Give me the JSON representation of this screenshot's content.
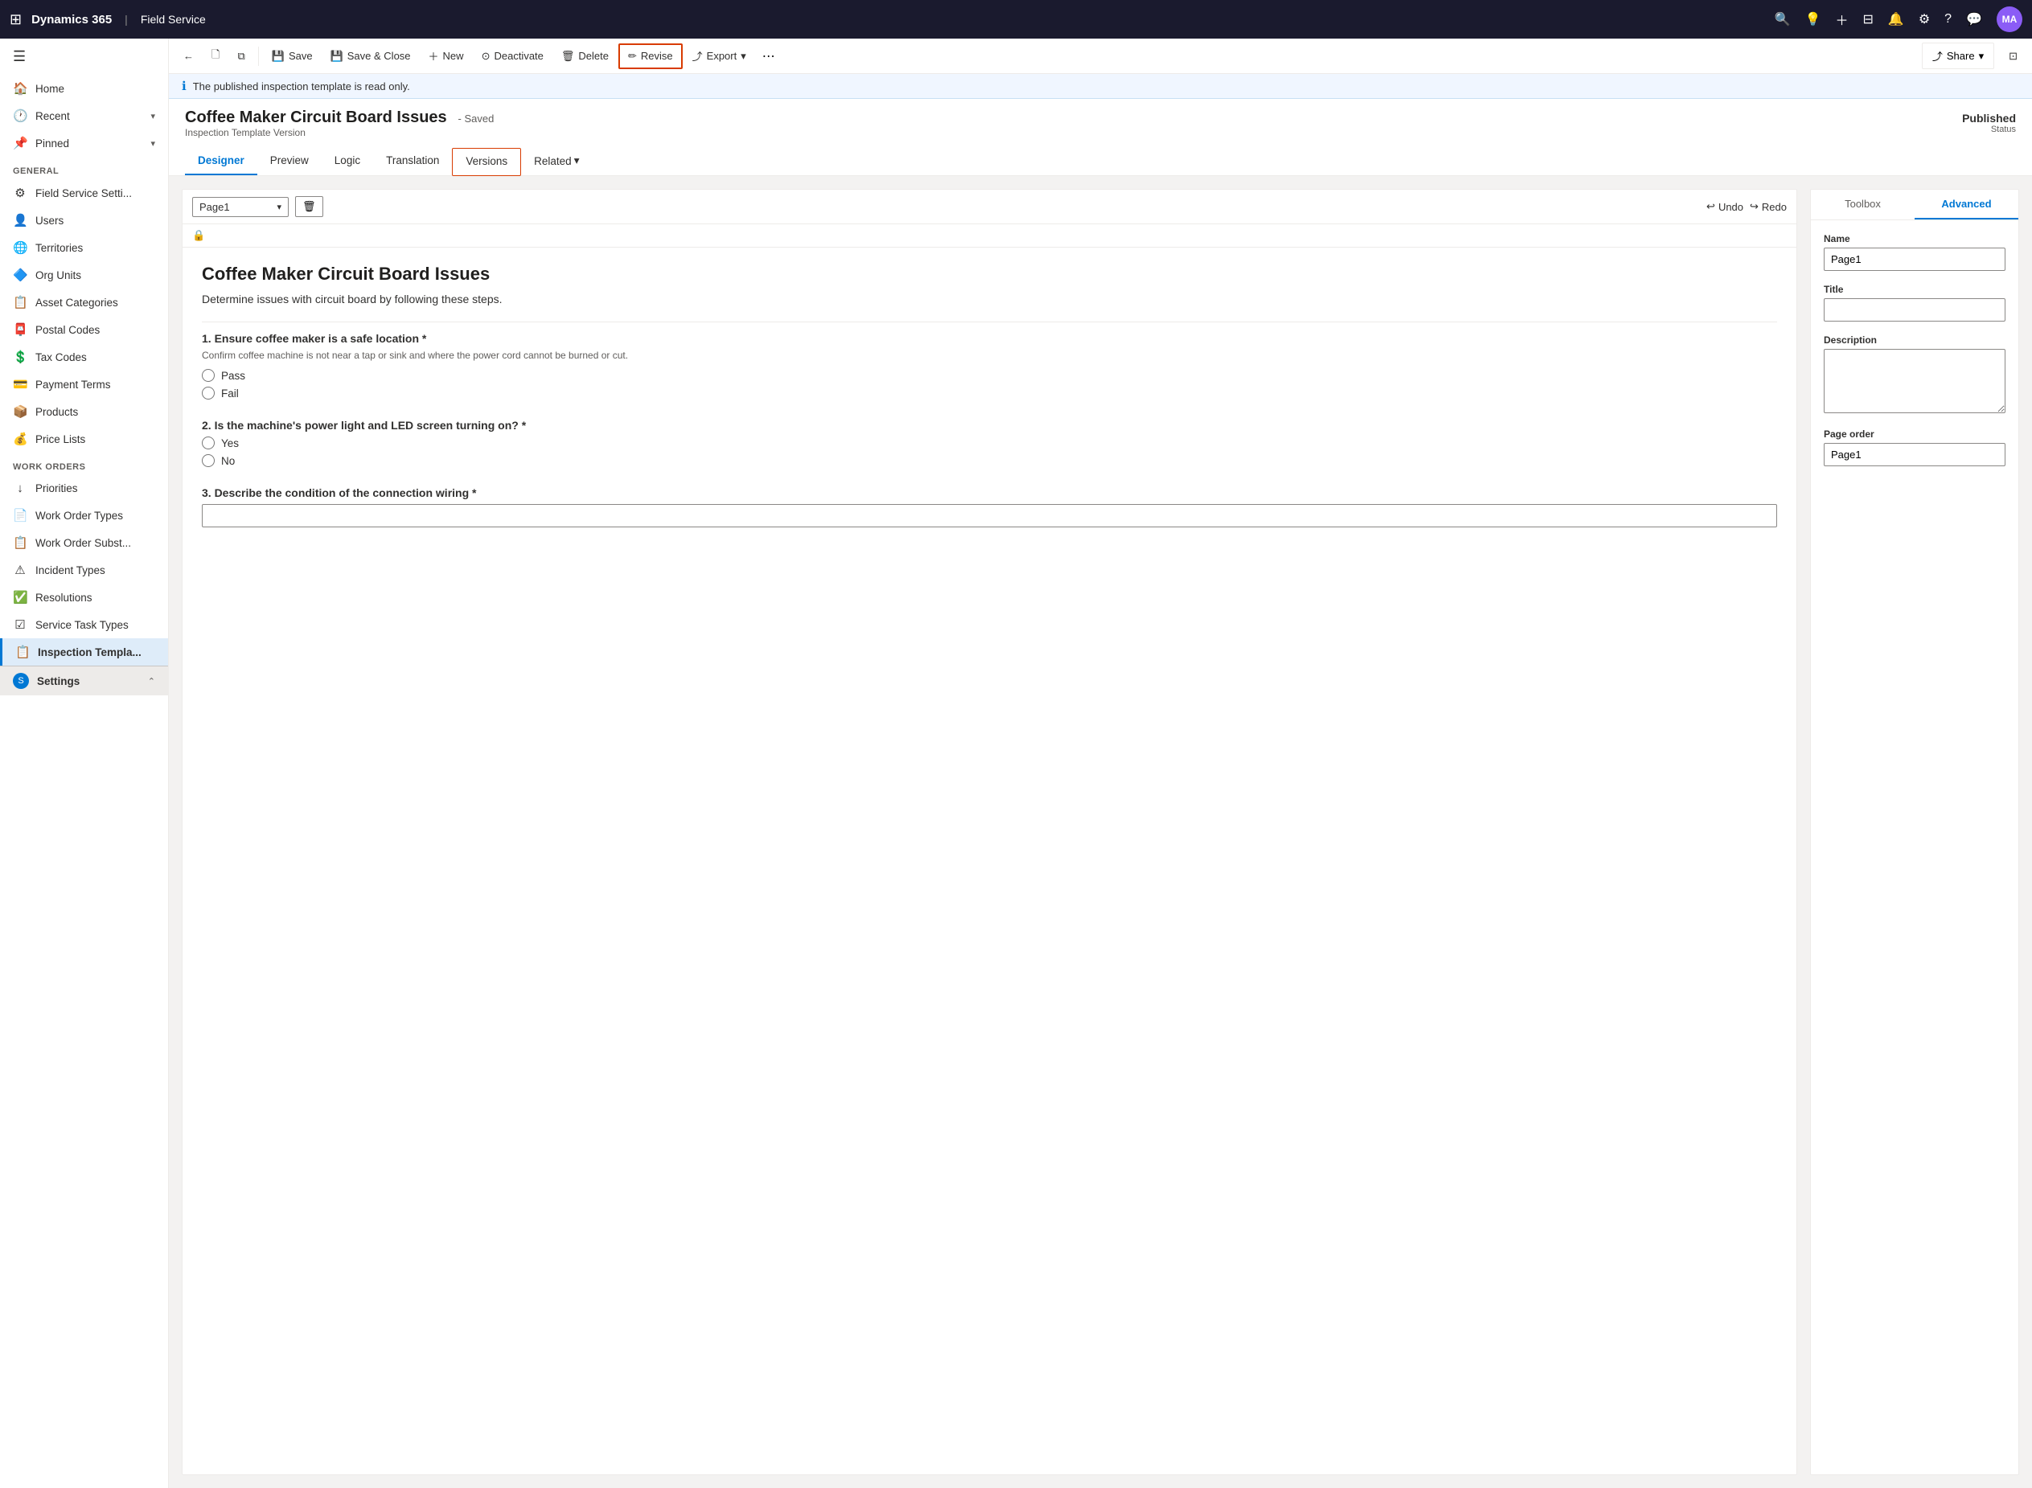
{
  "topnav": {
    "brand": "Dynamics 365",
    "separator": "|",
    "module": "Field Service",
    "avatar_initials": "MA"
  },
  "toolbar": {
    "back_label": "",
    "save_label": "Save",
    "save_close_label": "Save & Close",
    "new_label": "New",
    "deactivate_label": "Deactivate",
    "delete_label": "Delete",
    "revise_label": "Revise",
    "export_label": "Export",
    "share_label": "Share"
  },
  "info_bar": {
    "message": "The published inspection template is read only."
  },
  "page": {
    "title": "Coffee Maker Circuit Board Issues",
    "saved_label": "- Saved",
    "subtitle": "Inspection Template Version",
    "status_value": "Published",
    "status_label": "Status"
  },
  "tabs": [
    {
      "id": "designer",
      "label": "Designer",
      "active": true
    },
    {
      "id": "preview",
      "label": "Preview"
    },
    {
      "id": "logic",
      "label": "Logic"
    },
    {
      "id": "translation",
      "label": "Translation"
    },
    {
      "id": "versions",
      "label": "Versions",
      "highlight": true
    },
    {
      "id": "related",
      "label": "Related",
      "dropdown": true
    }
  ],
  "designer": {
    "page_name": "Page1",
    "undo_label": "Undo",
    "redo_label": "Redo",
    "form_title": "Coffee Maker Circuit Board Issues",
    "form_description": "Determine issues with circuit board by following these steps.",
    "questions": [
      {
        "id": "q1",
        "text": "1. Ensure coffee maker is a safe location *",
        "hint": "Confirm coffee machine is not near a tap or sink and where the power cord cannot be burned or cut.",
        "type": "radio",
        "options": [
          "Pass",
          "Fail"
        ]
      },
      {
        "id": "q2",
        "text": "2. Is the machine's power light and LED screen turning on? *",
        "hint": "",
        "type": "radio",
        "options": [
          "Yes",
          "No"
        ]
      },
      {
        "id": "q3",
        "text": "3. Describe the condition of the connection wiring *",
        "hint": "",
        "type": "text",
        "options": []
      }
    ]
  },
  "advanced_panel": {
    "toolbox_label": "Toolbox",
    "advanced_label": "Advanced",
    "name_label": "Name",
    "name_value": "Page1",
    "title_label": "Title",
    "title_value": "",
    "description_label": "Description",
    "description_value": "",
    "page_order_label": "Page order",
    "page_order_value": "Page1"
  },
  "sidebar": {
    "hamburger": "☰",
    "general_section": "General",
    "work_orders_section": "Work Orders",
    "items": [
      {
        "id": "home",
        "icon": "🏠",
        "label": "Home"
      },
      {
        "id": "recent",
        "icon": "🕐",
        "label": "Recent",
        "expand": true
      },
      {
        "id": "pinned",
        "icon": "📌",
        "label": "Pinned",
        "expand": true
      },
      {
        "id": "field-service-settings",
        "icon": "⚙",
        "label": "Field Service Setti..."
      },
      {
        "id": "users",
        "icon": "👤",
        "label": "Users"
      },
      {
        "id": "territories",
        "icon": "🌐",
        "label": "Territories"
      },
      {
        "id": "org-units",
        "icon": "🔷",
        "label": "Org Units"
      },
      {
        "id": "asset-categories",
        "icon": "📋",
        "label": "Asset Categories"
      },
      {
        "id": "postal-codes",
        "icon": "📮",
        "label": "Postal Codes"
      },
      {
        "id": "tax-codes",
        "icon": "💲",
        "label": "Tax Codes"
      },
      {
        "id": "payment-terms",
        "icon": "💳",
        "label": "Payment Terms"
      },
      {
        "id": "products",
        "icon": "📦",
        "label": "Products"
      },
      {
        "id": "price-lists",
        "icon": "💰",
        "label": "Price Lists"
      },
      {
        "id": "priorities",
        "icon": "↓",
        "label": "Priorities"
      },
      {
        "id": "work-order-types",
        "icon": "📄",
        "label": "Work Order Types"
      },
      {
        "id": "work-order-subst",
        "icon": "📋",
        "label": "Work Order Subst..."
      },
      {
        "id": "incident-types",
        "icon": "⚠",
        "label": "Incident Types"
      },
      {
        "id": "resolutions",
        "icon": "✅",
        "label": "Resolutions"
      },
      {
        "id": "service-task-types",
        "icon": "☑",
        "label": "Service Task Types"
      },
      {
        "id": "inspection-templates",
        "icon": "📋",
        "label": "Inspection Templa...",
        "active": true
      }
    ],
    "settings_label": "Settings"
  }
}
